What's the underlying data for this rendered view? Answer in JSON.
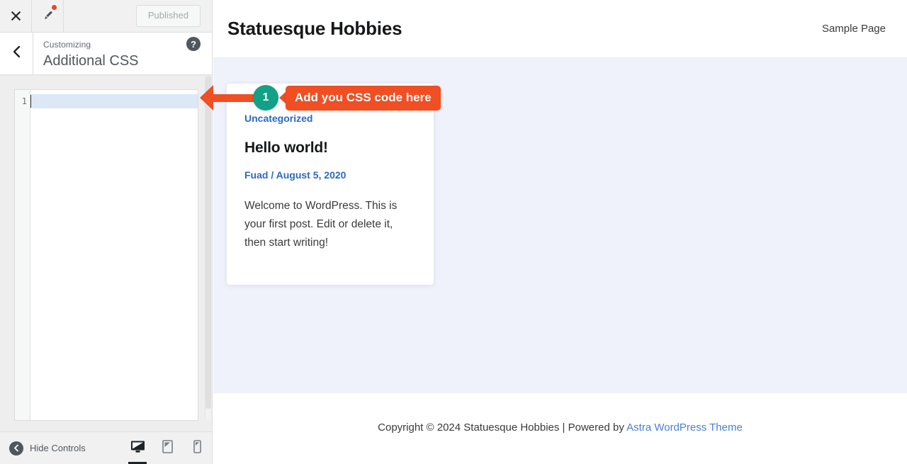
{
  "customizer": {
    "topbar": {
      "close_icon": "close-x-icon",
      "brush_icon": "paintbrush-icon",
      "publish_label": "Published"
    },
    "panel_header": {
      "back_icon": "chevron-left-icon",
      "eyebrow": "Customizing",
      "title": "Additional CSS",
      "help_icon": "help-question-icon"
    },
    "editor": {
      "line_numbers": [
        "1"
      ],
      "lines": [
        ""
      ],
      "active_line_index": 0
    },
    "bottom_bar": {
      "hide_controls_label": "Hide Controls",
      "hide_controls_icon": "arrow-left-circle-icon",
      "devices": [
        {
          "name": "desktop",
          "icon": "desktop-monitor-icon",
          "active": true
        },
        {
          "name": "tablet",
          "icon": "tablet-icon",
          "active": false
        },
        {
          "name": "mobile",
          "icon": "mobile-phone-icon",
          "active": false
        }
      ]
    }
  },
  "preview": {
    "header": {
      "site_title": "Statuesque Hobbies",
      "nav": [
        {
          "label": "Sample Page"
        }
      ]
    },
    "post": {
      "category": "Uncategorized",
      "title": "Hello world!",
      "author": "Fuad",
      "meta_separator": " / ",
      "date": "August 5, 2020",
      "excerpt": "Welcome to WordPress. This is your first post. Edit or delete it, then start writing!"
    },
    "footer": {
      "text": "Copyright © 2024 Statuesque Hobbies | Powered by ",
      "link": "Astra WordPress Theme"
    }
  },
  "annotation": {
    "badge_number": "1",
    "label": "Add you CSS code here",
    "accent_color": "#f04e23",
    "badge_color": "#12a087"
  }
}
